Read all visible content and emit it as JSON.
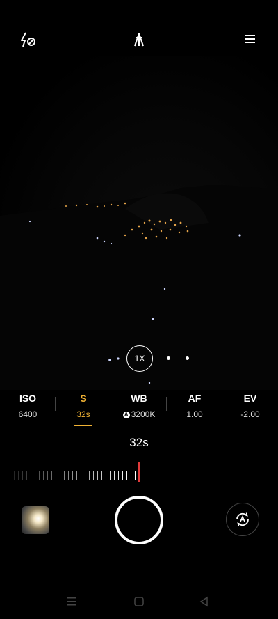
{
  "topbar": {
    "flash_icon": "flash-off-icon",
    "mode_icon": "tripod-icon",
    "menu_icon": "hamburger-menu-icon"
  },
  "zoom": {
    "label": "1X"
  },
  "params": [
    {
      "name": "ISO",
      "value": "6400"
    },
    {
      "name": "S",
      "value": "32s"
    },
    {
      "name": "WB",
      "value": "3200K",
      "prefix": "A"
    },
    {
      "name": "AF",
      "value": "1.00"
    },
    {
      "name": "EV",
      "value": "-2.00"
    }
  ],
  "active_param": "S",
  "current_value": "32s",
  "colors": {
    "accent": "#f0b234",
    "needle": "#e23b3b"
  },
  "nav": {
    "recents": "recents-icon",
    "home": "home-icon",
    "back": "back-icon"
  }
}
